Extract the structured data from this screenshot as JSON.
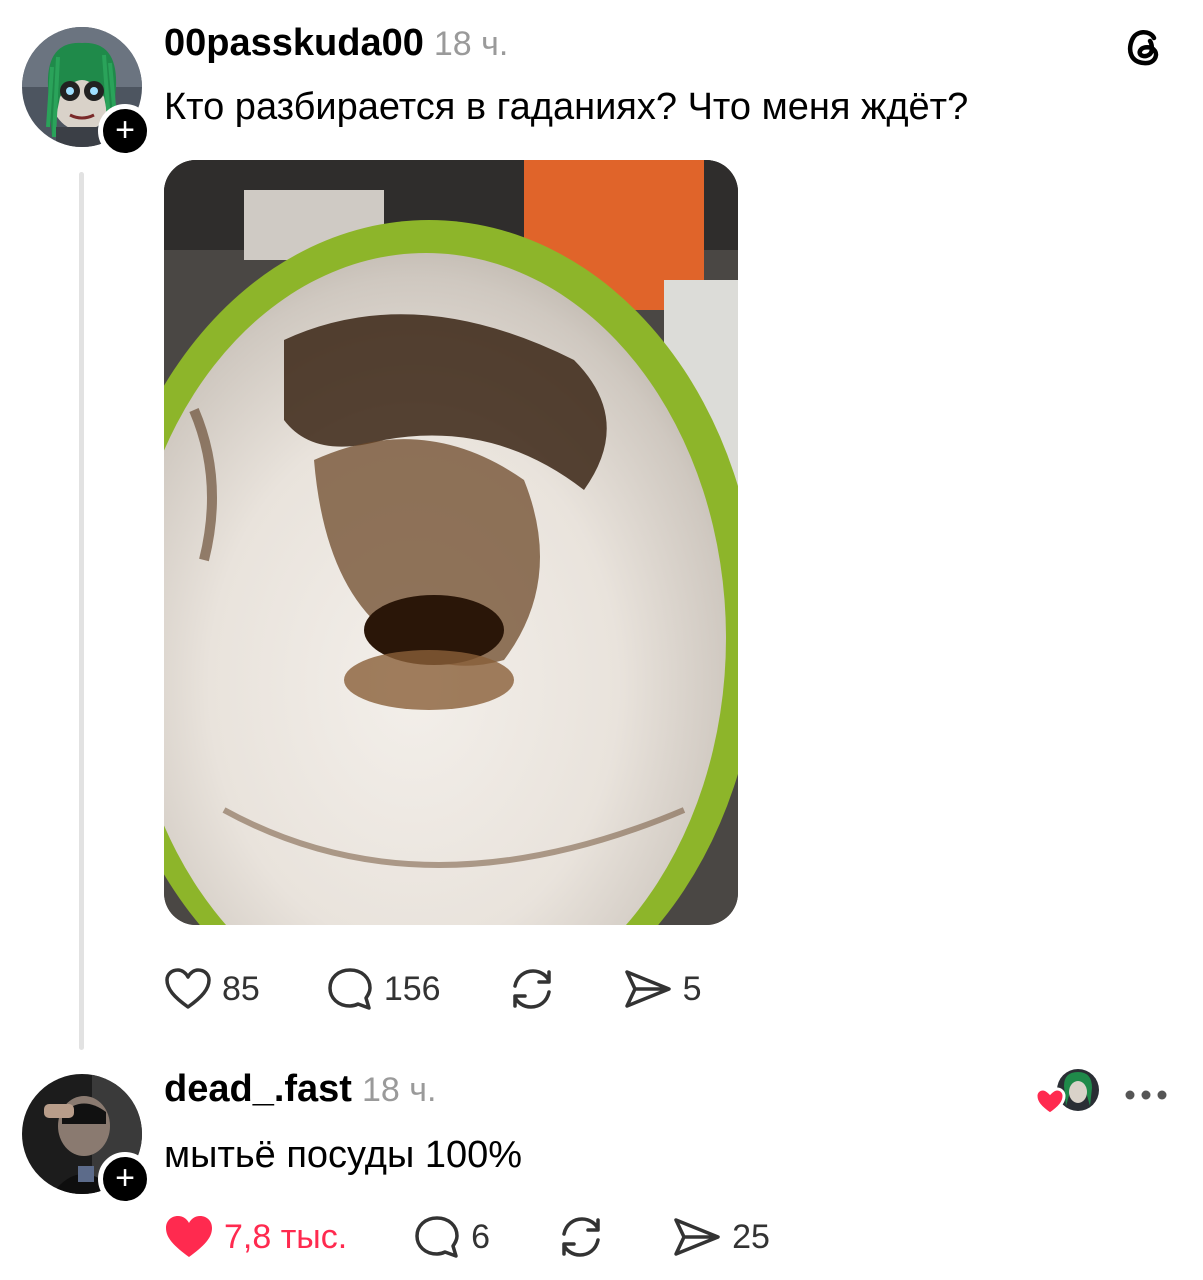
{
  "post": {
    "username": "00passkuda00",
    "time": "18 ч.",
    "text": "Кто разбирается в гаданиях? Что меня ждёт?",
    "stats": {
      "likes": "85",
      "comments": "156",
      "shares": "5"
    },
    "icons": [
      "threads-logo-icon",
      "plus-icon",
      "heart-icon",
      "comment-icon",
      "repost-icon",
      "share-icon"
    ]
  },
  "reply": {
    "username": "dead_.fast",
    "time": "18 ч.",
    "text": "мытьё посуды 100%",
    "stats": {
      "likes": "7,8 тыс.",
      "comments": "6",
      "shares": "25"
    },
    "icons": [
      "liked-by-author-icon",
      "more-icon",
      "heart-filled-icon"
    ]
  },
  "colors": {
    "accent_like": "#ff2a4f",
    "muted": "#9a9a9a",
    "thread_line": "#e2e2e2"
  }
}
